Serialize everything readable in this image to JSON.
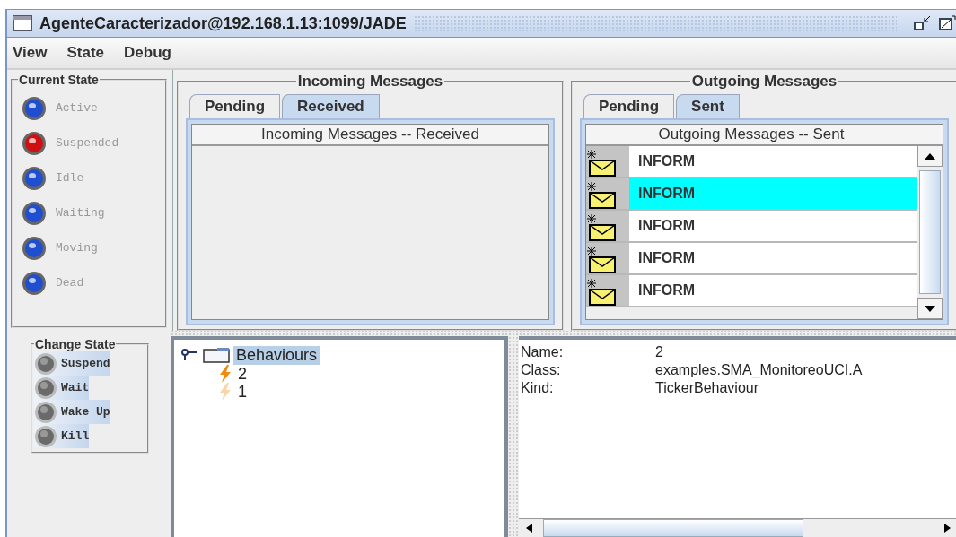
{
  "window": {
    "title": "AgenteCaracterizador@192.168.1.13:1099/JADE"
  },
  "menu": [
    "View",
    "State",
    "Debug"
  ],
  "current_state": {
    "title": "Current State",
    "states": [
      {
        "label": "Active",
        "color": "#1f4fd0"
      },
      {
        "label": "Suspended",
        "color": "#d01010"
      },
      {
        "label": "Idle",
        "color": "#1f4fd0"
      },
      {
        "label": "Waiting",
        "color": "#1f4fd0"
      },
      {
        "label": "Moving",
        "color": "#1f4fd0"
      },
      {
        "label": "Dead",
        "color": "#1f4fd0"
      }
    ]
  },
  "change_state": {
    "title": "Change State",
    "buttons": [
      "Suspend",
      "Wait",
      "Wake Up",
      "Kill"
    ]
  },
  "incoming": {
    "title": "Incoming Messages",
    "tabs": [
      {
        "label": "Pending",
        "selected": false
      },
      {
        "label": "Received",
        "selected": true
      }
    ],
    "column": "Incoming Messages -- Received"
  },
  "outgoing": {
    "title": "Outgoing Messages",
    "tabs": [
      {
        "label": "Pending",
        "selected": false
      },
      {
        "label": "Sent",
        "selected": true
      }
    ],
    "column": "Outgoing Messages -- Sent",
    "rows": [
      {
        "label": "INFORM",
        "selected": false
      },
      {
        "label": "INFORM",
        "selected": true
      },
      {
        "label": "INFORM",
        "selected": false
      },
      {
        "label": "INFORM",
        "selected": false
      },
      {
        "label": "INFORM",
        "selected": false
      }
    ]
  },
  "behaviours": {
    "label": "Behaviours",
    "selected": true,
    "expanded": true,
    "children": [
      {
        "label": "2",
        "active": true
      },
      {
        "label": "1",
        "active": false
      }
    ]
  },
  "details": [
    {
      "key": "Name:",
      "value": "2"
    },
    {
      "key": "Class:",
      "value": "examples.SMA_MonitoreoUCI.A"
    },
    {
      "key": "Kind:",
      "value": "TickerBehaviour"
    }
  ]
}
